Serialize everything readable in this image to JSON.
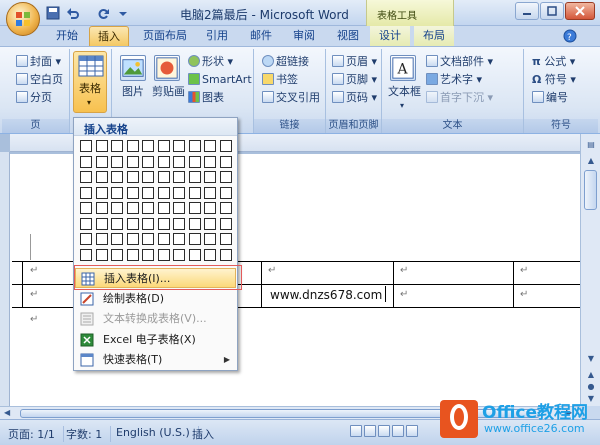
{
  "window": {
    "title": "电脑2篇最后 - Microsoft Word",
    "context_tab_group": "表格工具"
  },
  "tabs": [
    {
      "label": "开始"
    },
    {
      "label": "插入"
    },
    {
      "label": "页面布局"
    },
    {
      "label": "引用"
    },
    {
      "label": "邮件"
    },
    {
      "label": "审阅"
    },
    {
      "label": "视图"
    },
    {
      "label": "设计"
    },
    {
      "label": "布局"
    }
  ],
  "ribbon": {
    "pages": {
      "cover": "封面",
      "blank": "空白页",
      "break": "分页",
      "label": "页"
    },
    "table": {
      "button": "表格",
      "label": "表格"
    },
    "illustrations": {
      "picture": "图片",
      "clipart": "剪贴画",
      "shapes": "形状",
      "smartart": "SmartArt",
      "chart": "图表"
    },
    "links": {
      "hyperlink": "超链接",
      "bookmark": "书签",
      "crossref": "交叉引用",
      "label": "链接"
    },
    "header_footer": {
      "header": "页眉",
      "footer": "页脚",
      "page_number": "页码",
      "label": "页眉和页脚"
    },
    "text": {
      "textbox": "文本框",
      "quickparts": "文档部件",
      "wordart": "艺术字",
      "dropcap": "首字下沉",
      "label": "文本"
    },
    "symbols": {
      "equation": "公式",
      "symbol": "符号",
      "number": "编号",
      "label": "符号"
    }
  },
  "dropdown": {
    "title": "插入表格",
    "items": [
      {
        "label": "插入表格(I)..."
      },
      {
        "label": "绘制表格(D)"
      },
      {
        "label": "文本转换成表格(V)..."
      },
      {
        "label": "Excel 电子表格(X)"
      },
      {
        "label": "快速表格(T)"
      }
    ]
  },
  "document": {
    "cell_text": "www.dnzs678.com",
    "paragraph_mark": "↵"
  },
  "status": {
    "page": "页面: 1/1",
    "words": "字数: 1",
    "language": "English (U.S.)",
    "mode": "插入"
  },
  "watermark": {
    "brand": "Office教程网",
    "url": "www.office26.com"
  }
}
